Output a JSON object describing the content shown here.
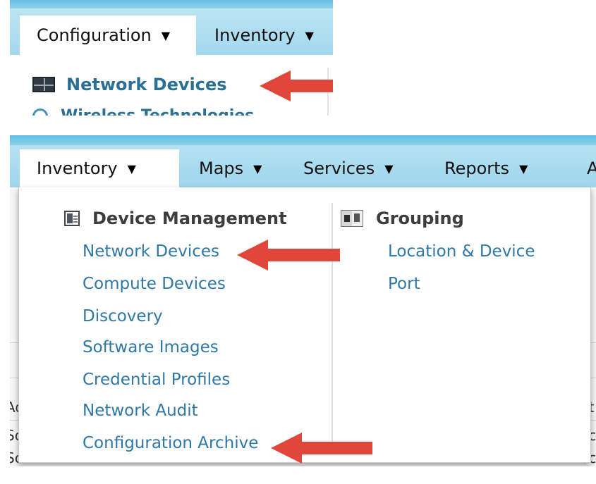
{
  "top_panel": {
    "tabs": [
      {
        "label": "Configuration"
      },
      {
        "label": "Inventory"
      }
    ],
    "menu": {
      "network_devices_label": "Network Devices",
      "cut_off_label": "Wireless Technologies"
    },
    "caret": "▼"
  },
  "bottom_panel": {
    "tabs": [
      {
        "label": "Inventory"
      },
      {
        "label": "Maps"
      },
      {
        "label": "Services"
      },
      {
        "label": "Reports"
      },
      {
        "label": "A"
      }
    ],
    "caret": "▼",
    "device_management": {
      "header": "Device Management",
      "items": [
        "Network Devices",
        "Compute Devices",
        "Discovery",
        "Software Images",
        "Credential Profiles",
        "Network Audit",
        "Configuration Archive"
      ]
    },
    "grouping": {
      "header": "Grouping",
      "items": [
        "Location & Device",
        "Port"
      ]
    },
    "background_fragments": [
      "Ad",
      "Sc",
      "Sc",
      "St",
      "ec",
      "ec"
    ]
  },
  "colors": {
    "nav_gradient": "#a4d8ee",
    "link": "#2f78a6",
    "arrow": "#e0473a"
  },
  "icons": [
    "grid-icon",
    "wireless-icon",
    "device-management-icon",
    "grouping-icon",
    "red-arrow"
  ]
}
